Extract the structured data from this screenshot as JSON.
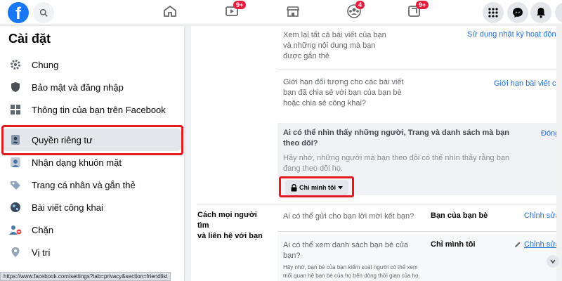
{
  "topbar": {
    "logo_letter": "f",
    "badges": {
      "watch": "9+",
      "groups": "4",
      "gaming": "9+"
    }
  },
  "sidebar": {
    "title": "Cài đặt",
    "items": [
      {
        "label": "Chung",
        "icon": "gear-icon"
      },
      {
        "label": "Bảo mật và đăng nhập",
        "icon": "shield-icon"
      },
      {
        "label": "Thông tin của bạn trên Facebook",
        "icon": "grid-icon"
      },
      {
        "label": "Quyền riêng tư",
        "icon": "lock-person-icon",
        "active": true
      },
      {
        "label": "Nhận dạng khuôn mặt",
        "icon": "face-icon"
      },
      {
        "label": "Trang cá nhân và gắn thẻ",
        "icon": "tag-icon"
      },
      {
        "label": "Bài viết công khai",
        "icon": "globe-icon"
      },
      {
        "label": "Chặn",
        "icon": "block-user-icon"
      },
      {
        "label": "Vị trí",
        "icon": "location-icon"
      }
    ]
  },
  "statusbar": {
    "url": "https://www.facebook.com/settings?tab=privacy&section=friendlist"
  },
  "main": {
    "row1": {
      "text": [
        "Xem lại tất cả bài viết của bạn",
        "và những nội dung mà bạn",
        "được gắn thẻ"
      ],
      "link": "Sử dụng nhật ký hoạt động"
    },
    "row2": {
      "text": [
        "Giới hạn đối tượng cho các bài viết",
        "bạn đã chia sẻ với bạn của bạn bè",
        "hoặc chia sẻ công khai?"
      ],
      "link": "Giới hạn bài viết cũ"
    },
    "row3": {
      "question": [
        "Ai có thể nhìn thấy những người, Trang và danh sách mà bạn",
        "theo dõi?"
      ],
      "hint": [
        "Hãy nhớ, những người mà bạn theo dõi có thể nhìn thấy rằng bạn",
        "đang theo dõi họ."
      ],
      "close": "Đóng",
      "button": "Chỉ mình tôi"
    },
    "section": {
      "label": [
        "Cách mọi người tìm",
        "và liên hệ với bạn"
      ]
    },
    "row4": {
      "question": "Ai có thể gửi cho bạn lời mời kết bạn?",
      "value": "Bạn của bạn bè",
      "edit": "Chỉnh sửa"
    },
    "row5": {
      "question": [
        "Ai có thể xem danh sách bạn bè của",
        "bạn?"
      ],
      "value": "Chỉ mình tôi",
      "edit": "Chỉnh sửa",
      "hint": [
        "Hãy nhớ, bạn bè của bạn kiểm soát người có thể xem",
        "mối quan hệ bạn bè của họ trên dòng thời gian của họ."
      ]
    }
  },
  "colors": {
    "accent": "#1877f2",
    "link": "#216fdb",
    "highlight_box": "#e01b24",
    "badge": "#e41e3f"
  }
}
